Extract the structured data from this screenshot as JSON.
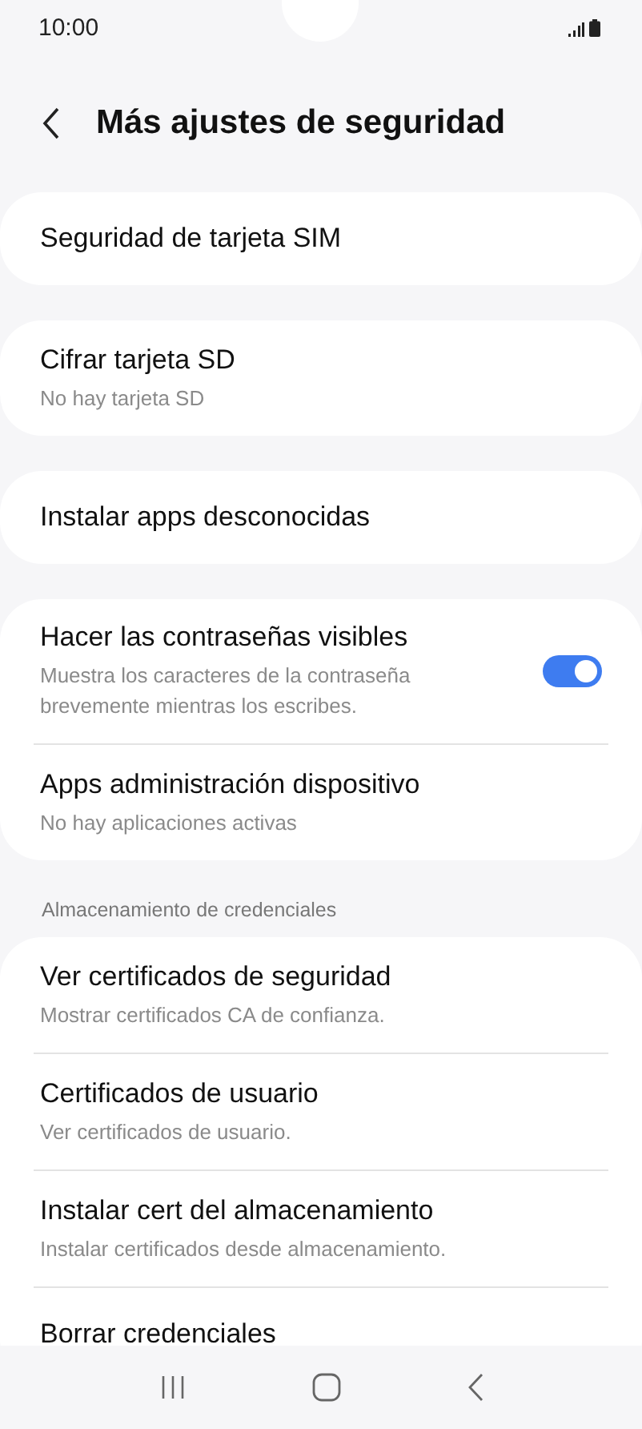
{
  "status_bar": {
    "time": "10:00"
  },
  "header": {
    "title": "Más ajustes de seguridad"
  },
  "groups": [
    {
      "items": [
        {
          "kind": "link",
          "title": "Seguridad de tarjeta SIM"
        }
      ]
    },
    {
      "items": [
        {
          "kind": "link",
          "title": "Cifrar tarjeta SD",
          "subtitle": "No hay tarjeta SD"
        }
      ]
    },
    {
      "items": [
        {
          "kind": "link",
          "title": "Instalar apps desconocidas"
        }
      ]
    },
    {
      "items": [
        {
          "kind": "toggle",
          "title": "Hacer las contraseñas visibles",
          "subtitle": "Muestra los caracteres de la contraseña brevemente mientras los escribes.",
          "on": true
        },
        {
          "kind": "link",
          "title": "Apps administración dispositivo",
          "subtitle": "No hay aplicaciones activas"
        }
      ]
    },
    {
      "header": "Almacenamiento de credenciales",
      "items": [
        {
          "kind": "link",
          "title": "Ver certificados de seguridad",
          "subtitle": "Mostrar certificados CA de confianza."
        },
        {
          "kind": "link",
          "title": "Certificados de usuario",
          "subtitle": "Ver certificados de usuario."
        },
        {
          "kind": "link",
          "title": "Instalar cert del almacenamiento",
          "subtitle": "Instalar certificados desde almacenamiento."
        },
        {
          "kind": "link",
          "title": "Borrar credenciales"
        }
      ]
    }
  ]
}
